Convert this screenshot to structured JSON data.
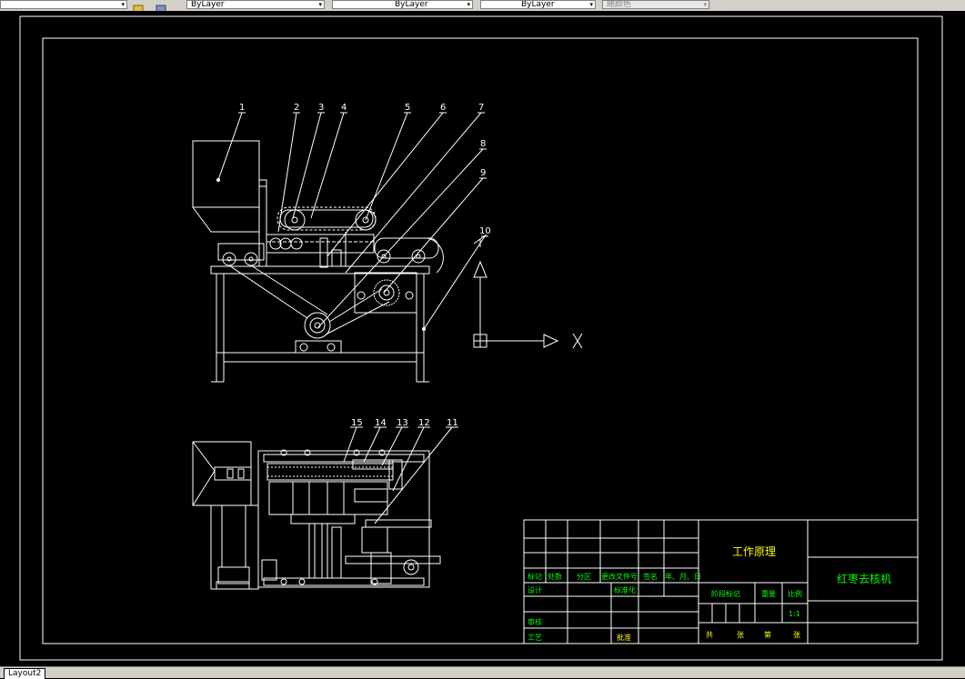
{
  "toolbar": {
    "layer_color": "ByLayer",
    "linetype": "ByLayer",
    "lineweight": "ByLayer",
    "plotstyle": "随颜色"
  },
  "layout_tab": "Layout2",
  "title_block": {
    "principle": "工作原理",
    "machine_name": "红枣去核机",
    "stage_mark": "阶段标记",
    "weight": "重量",
    "scale_label": "比例",
    "scale_value": "1:1",
    "sheet_total": "共",
    "sheet_unit1": "张",
    "sheet_no": "第",
    "sheet_unit2": "张",
    "marks": "标记",
    "count": "处数",
    "zone": "分区",
    "change_doc": "更改文件号",
    "signature": "签名",
    "date": "年、月、日",
    "design": "设计",
    "standardize": "标准化",
    "review": "审核",
    "process": "工艺",
    "approve": "批准"
  },
  "part_numbers": {
    "front": [
      "1",
      "2",
      "3",
      "4",
      "5",
      "6",
      "7",
      "8",
      "9",
      "10"
    ],
    "top": [
      "15",
      "14",
      "13",
      "12",
      "11"
    ]
  },
  "ucs": {
    "x_label": "X"
  },
  "colors": {
    "line": "#ffffff",
    "text_green": "#00ff00",
    "text_yellow": "#ffff00"
  }
}
